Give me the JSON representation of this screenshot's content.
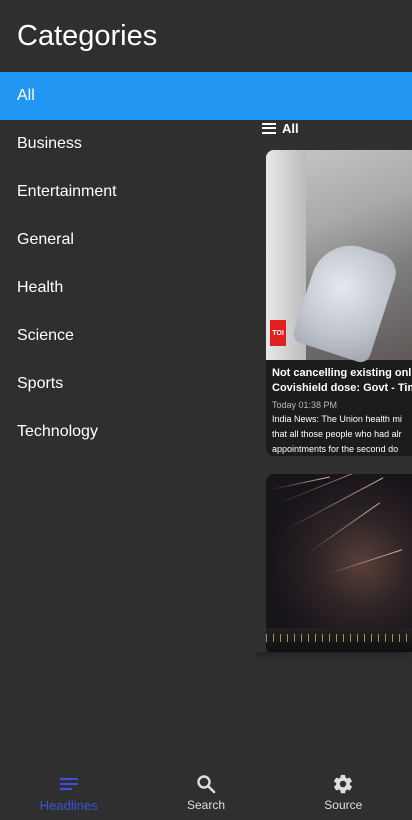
{
  "drawer": {
    "title": "Categories",
    "categories": [
      "All",
      "Business",
      "Entertainment",
      "General",
      "Health",
      "Science",
      "Sports",
      "Technology"
    ],
    "selected": "All"
  },
  "background_screen": {
    "appbar_title": "All",
    "articles": [
      {
        "source_badge": "TOI",
        "title_line1": "Not cancelling existing onl",
        "title_line2": "Covishield dose: Govt - Tim",
        "time": "Today 01:38 PM",
        "desc_line1": "India News: The Union health mi",
        "desc_line2": "that all those people who had alr",
        "desc_line3": "appointments for the second do"
      },
      {}
    ]
  },
  "bottom_nav": {
    "items": [
      {
        "label": "Headlines",
        "icon": "headlines-icon"
      },
      {
        "label": "Search",
        "icon": "search-icon"
      },
      {
        "label": "Source",
        "icon": "gear-icon"
      }
    ],
    "active_color": "#3d51d8"
  },
  "colors": {
    "accent": "#2196f3",
    "background": "#2f2f2f"
  }
}
